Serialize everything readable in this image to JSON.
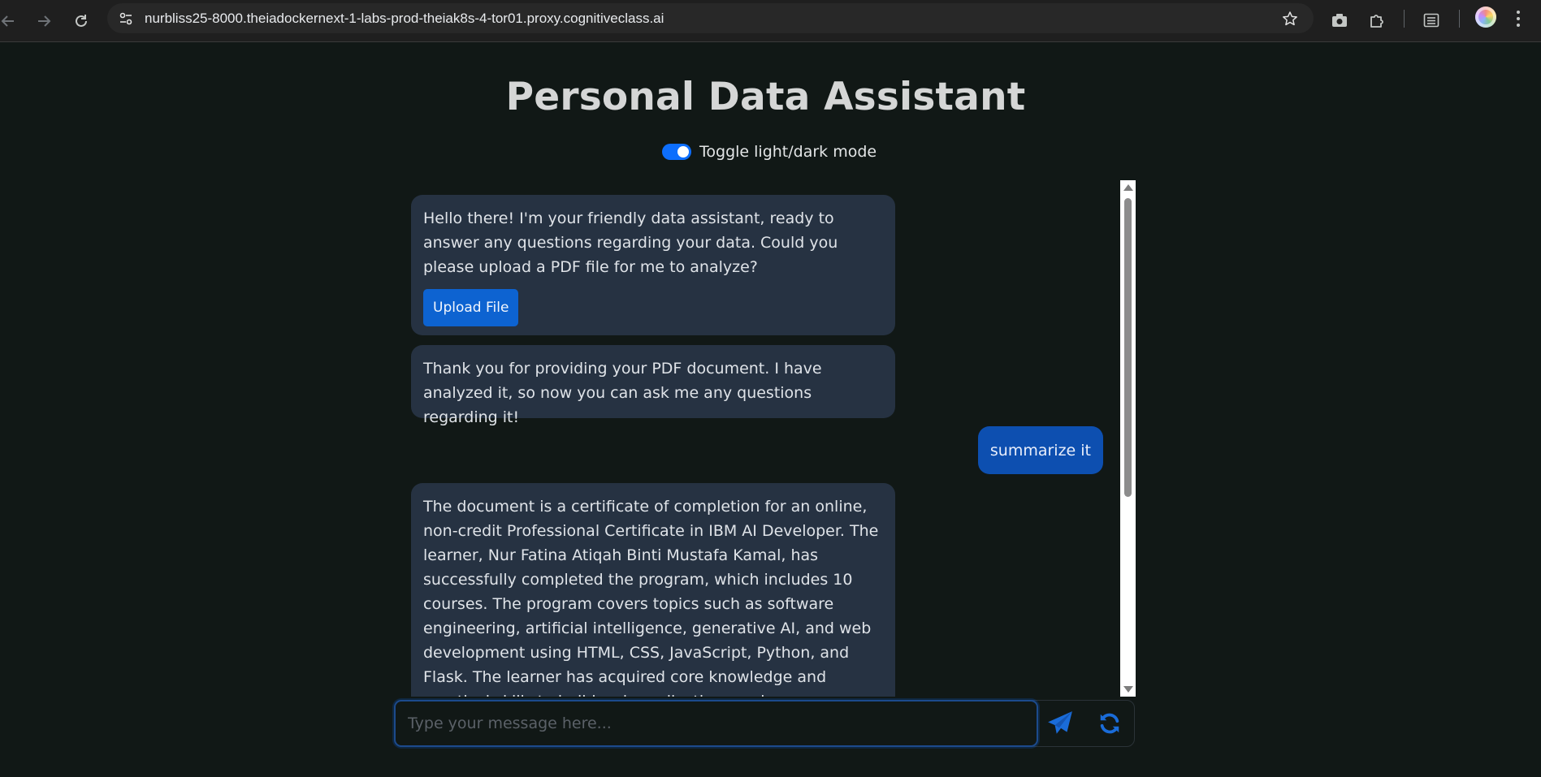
{
  "browser": {
    "url": "nurbliss25-8000.theiadockernext-1-labs-prod-theiak8s-4-tor01.proxy.cognitiveclass.ai"
  },
  "page": {
    "title": "Personal Data Assistant",
    "toggle_label": "Toggle light/dark mode",
    "toggle_on": true
  },
  "chat": {
    "messages": [
      {
        "role": "bot",
        "text": "Hello there! I'm your friendly data assistant, ready to answer any questions regarding your data. Could you please upload a PDF file for me to analyze?",
        "button_label": "Upload File"
      },
      {
        "role": "bot",
        "text": "Thank you for providing your PDF document. I have analyzed it, so now you can ask me any questions regarding it!"
      },
      {
        "role": "user",
        "text": "summarize it"
      },
      {
        "role": "bot",
        "text": "The document is a certificate of completion for an online, non-credit Professional Certificate in IBM AI Developer. The learner, Nur Fatina Atiqah Binti Mustafa Kamal, has successfully completed the program, which includes 10 courses. The program covers topics such as software engineering, artificial intelligence, generative AI, and web development using HTML, CSS, JavaScript, Python, and Flask. The learner has acquired core knowledge and practical skills to build web applications and"
      }
    ]
  },
  "composer": {
    "placeholder": "Type your message here..."
  },
  "colors": {
    "accent": "#0d6efd",
    "bot_bubble": "#263242",
    "user_bubble": "#0d4fb0",
    "background": "#111816"
  },
  "icons": {
    "send": "paper-plane-icon",
    "refresh": "refresh-icon"
  }
}
